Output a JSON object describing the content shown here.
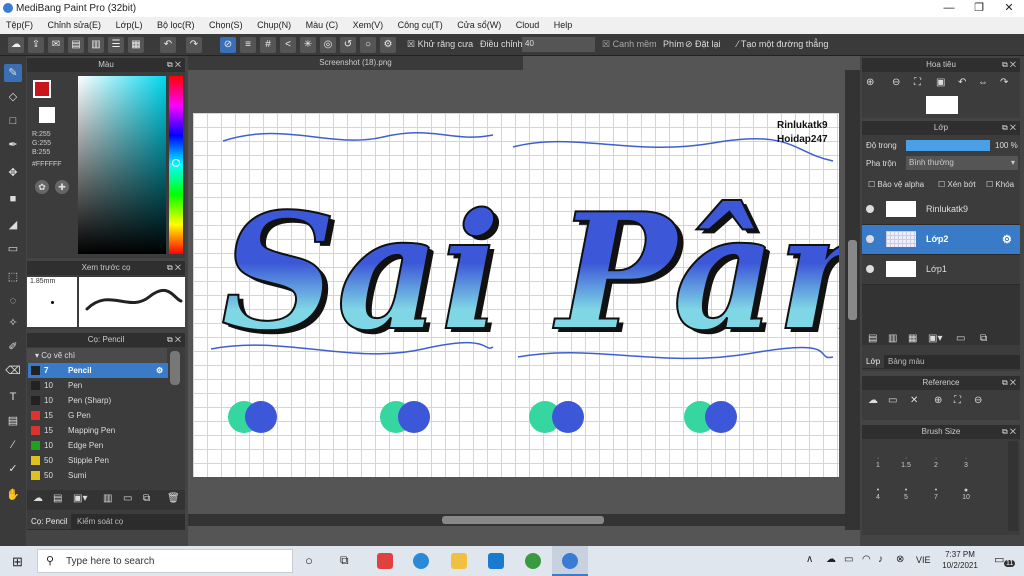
{
  "title": "MediBang Paint Pro (32bit)",
  "window_controls": [
    "—",
    "❐",
    "✕"
  ],
  "menu": [
    "Tệp(F)",
    "Chỉnh sửa(E)",
    "Lớp(L)",
    "Bộ lọc(R)",
    "Chọn(S)",
    "Chụp(N)",
    "Màu (C)",
    "Xem(V)",
    "Công cụ(T)",
    "Cửa sổ(W)",
    "Cloud",
    "Help"
  ],
  "toolbar": {
    "antialias": "Khử răng cưa",
    "adjust_label": "Điều chỉnh",
    "adjust_value": "40",
    "snap": "Canh mềm",
    "hotkey": "Phím",
    "reset": "Đặt lại",
    "new_ruler": "Tạo một đường thẳng"
  },
  "color_panel": {
    "title": "Màu",
    "r": "R:255",
    "g": "G:255",
    "b": "B:255",
    "hex": "#FFFFFF",
    "fg": "#c8161c",
    "bg": "#ffffff"
  },
  "preview_panel": {
    "title": "Xem trước cọ",
    "size": "1.85mm"
  },
  "brush_panel": {
    "title": "Cọ: Pencil",
    "group": "Cọ vẽ chì",
    "items": [
      {
        "size": "7",
        "name": "Pencil",
        "color": "#222222",
        "selected": true
      },
      {
        "size": "10",
        "name": "Pen",
        "color": "#222222"
      },
      {
        "size": "10",
        "name": "Pen (Sharp)",
        "color": "#222222"
      },
      {
        "size": "15",
        "name": "G Pen",
        "color": "#e03030"
      },
      {
        "size": "15",
        "name": "Mapping Pen",
        "color": "#e03030"
      },
      {
        "size": "10",
        "name": "Edge Pen",
        "color": "#20a020"
      },
      {
        "size": "50",
        "name": "Stipple Pen",
        "color": "#e0c020"
      },
      {
        "size": "50",
        "name": "Sumi",
        "color": "#e0c020"
      }
    ],
    "tabs": [
      "Cọ: Pencil",
      "Kiểm soát cọ"
    ]
  },
  "document": {
    "tab": "Screenshot (18).png",
    "watermark1": "Rinlukatk9",
    "watermark2": "Hoidap247",
    "art_text": "Sai Pâm"
  },
  "navigator": {
    "title": "Hoa tiêu"
  },
  "layer_panel": {
    "title": "Lớp",
    "opacity_label": "Độ trong",
    "opacity_value": "100 %",
    "opacity": 1.0,
    "blend_label": "Pha trộn",
    "blend_value": "Bình thường",
    "checks": [
      "Bảo vệ alpha",
      "Xén bớt",
      "Khóa"
    ],
    "layers": [
      {
        "name": "Rinlukatk9",
        "selected": false
      },
      {
        "name": "Lớp2",
        "selected": true
      },
      {
        "name": "Lớp1",
        "selected": false
      }
    ],
    "tabs": [
      "Lớp",
      "Bảng màu"
    ]
  },
  "reference_panel": {
    "title": "Reference"
  },
  "brush_size_panel": {
    "title": "Brush Size",
    "sizes": [
      "1",
      "1.5",
      "2",
      "3",
      "4",
      "5",
      "7",
      "10"
    ]
  },
  "taskbar": {
    "search": "Type here to search",
    "lang": "VIE",
    "time": "7:37 PM",
    "date": "10/2/2021",
    "notif": "11"
  }
}
